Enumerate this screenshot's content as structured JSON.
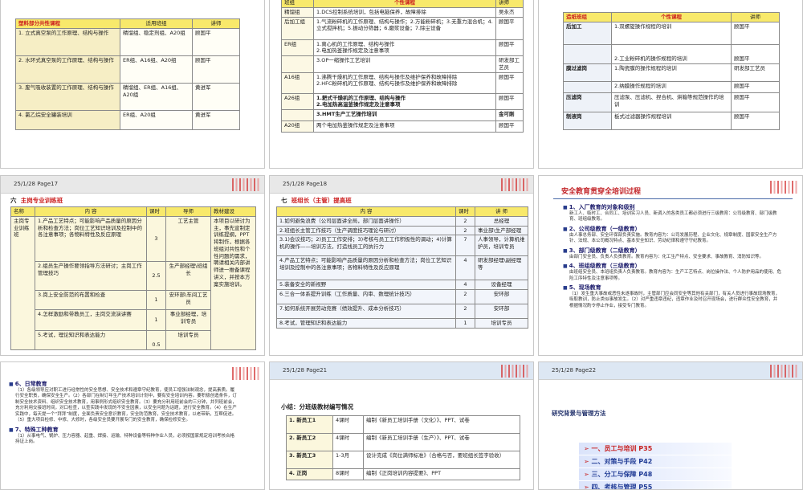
{
  "slide1": {
    "headers": [
      "塑料部分共性课程",
      "适用班组",
      "讲师"
    ],
    "rows": [
      [
        "1. 立式真空泵的工作原理、结构与操作",
        "精馏组、稳定剂组、A20组",
        "顾国平"
      ],
      [
        "2. 水环式真空泵的工作原理、结构与操作",
        "ER组、A16组、A20组",
        "顾国平"
      ],
      [
        "3. 废气吸收装置的工作原理、结构与操作",
        "精馏组、ER组、A16组、A20组",
        "黄进军"
      ],
      [
        "4. 氯乙烷安全罐装培训",
        "ER组、A20组",
        "黄进军"
      ]
    ]
  },
  "slide2": {
    "headers": [
      "班组",
      "个性课程",
      "讲师"
    ],
    "rows": [
      [
        "精馏组",
        "1.DCS控制系统培训，包括电脑保养，故障排除",
        "吴永杰"
      ],
      [
        "后加工组",
        "1.气流粉碎机的工作原理、结构与操作；2.万能粉碎机；3.无重力混合机；4.立式搅拌机；5.振动分筛器；6.磨浆设备；7.除尘设备",
        "顾国平"
      ],
      [
        "ER组",
        "1.离心机的工作原理、结构与操作\n2.电加热釜操作规定及注意事项",
        "顾国平"
      ],
      [
        "",
        "3.OP一缩操作工艺培训",
        "研发部工艺员"
      ],
      [
        "A16组",
        "1.沸腾干燥机的工作原理、结构与操作及维护保养和故障排除\n2.HFC粉碎机的工作原理、结构与操作及维护保养和故障排除",
        "顾国平"
      ],
      [
        "A26组",
        "1.耙式干燥机的工作原理、结构与操作\n2.电加热高温釜操作规定及注意事项",
        "顾国平"
      ],
      [
        "",
        "3.HMT生产工艺操作培训",
        "金可刚"
      ],
      [
        "A20组",
        "两个电加热釜操作规定及注意事项",
        "顾国平"
      ]
    ]
  },
  "slide3": {
    "headers": [
      "造纸班组",
      "个性课程",
      "讲师"
    ],
    "rows": [
      [
        "后加工",
        "1.双螺旋操作规程的培训",
        "顾国平"
      ],
      [
        "",
        "2.工业粉碎机的操作规程的培训",
        "顾国平"
      ],
      [
        "膜过滤岗",
        "1.陶瓷膜的操作规程的培训",
        "研发部工艺员"
      ],
      [
        "",
        "2.纳膜操作规程的培训",
        "顾国平"
      ],
      [
        "压滤岗",
        "压滤泵、压滤机、捏合机、烘箱等规范操作的培训",
        "顾国平"
      ],
      [
        "制液岗",
        "板式过滤器操作规程培训",
        "顾国平"
      ]
    ]
  },
  "slide4": {
    "page": "25/1/28   Page17",
    "title_num": "六",
    "title": "主岗专业训练班",
    "headers": [
      "名称",
      "内    容",
      "课时",
      "导师",
      "教材建设"
    ],
    "name": "主岗专业训练班",
    "material": "本项目以研讨为主，事先宣制定训练提纲，PPT将制作，根据各班组对共性和个性问题的需求，聘请相关内部讲师进一推备课程讲义，并按本方案实施培训。",
    "rows": [
      [
        "1.产品工艺特点；可能影响产品质量的原因分析和检查方法；岗位工艺知识培训及控制中的各注意事项；各物料特性及反应原理",
        "3",
        "工艺主管"
      ],
      [
        "2.组员生产操作要领指导方法研讨；主岗工作管理技巧",
        "2.5",
        "生产部经理\\班组长"
      ],
      [
        "3.岗上安全防范的布置和检查",
        "1",
        "安环部\\车间工艺员"
      ],
      [
        "4.怎样激励和带教员工，主岗交流演讲赛",
        "1",
        "事业部经理，培训专员"
      ],
      [
        "5.考试，理论知识和表达能力",
        "0.5",
        "培训专员"
      ]
    ]
  },
  "slide5": {
    "page": "25/1/28   Page18",
    "title_num": "七",
    "title": "班组长（主管）提高班",
    "headers": [
      "内    容",
      "课时",
      "讲    师"
    ],
    "rows": [
      [
        "1.如何避免浪费（公司层面讲全局，部门层面讲操作）",
        "2",
        "总经理"
      ],
      [
        "2.班组长主管工作技巧（生产调度技巧理论与研讨）",
        "2",
        "事业部\\生产部经理"
      ],
      [
        "3.1)会议技巧；2)员工工作安排；3)考核与员工工作积极性的调动；4)计算机的操作——培训方法，打造线员工的执行力",
        "7",
        "人事领导，计算机维护员，培训专员"
      ],
      [
        "4.产品工艺特点；可能影响产品质量的原因分析和检查方法；岗位工艺知识培训及控制中的各注意事项；各物料特性及反应原理",
        "4",
        "研发部经理\\副经理等"
      ],
      [
        "5.装备安全的新视野",
        "4",
        "设备经理"
      ],
      [
        "6.三合一体系提升训练（工作质量、内审、数理统计技巧）",
        "2",
        "安环部"
      ],
      [
        "7.如何系统开展劳动竞赛（绩效提升、成本分析技巧）",
        "2",
        "安环部"
      ],
      [
        "8.考试，管理知识和表达能力",
        "1",
        "培训专员"
      ]
    ]
  },
  "slide6": {
    "title": "安全教育贯穿全培训过程",
    "items": [
      {
        "h": "1、入厂教育的对象和级别",
        "p": "新工人、临时工、合同工、培训实习人员、新调入的各类员工都必须进行三级教育：公司级教育、部门级教育、班组级教育。"
      },
      {
        "h": "2、公司级教育（一级教育）",
        "p": "由人事总务部、安全环保部负责实施。教育内容为：公司发展历程、企业文化、规章制度、国家安全生产方针、法规、本公司概况特点、基本安全知识、劳动纪律和遵守守纪教育。"
      },
      {
        "h": "3、部门级教育（二级教育）",
        "p": "由部门安全员、负责人负责教育。教育内容为：化工生产特点、安全要求、事故教育、消防知识等。"
      },
      {
        "h": "4、班组级教育（三级教育）",
        "p": "由班组安全员、本班组负责人负责教育。教育内容为：生产工艺特点、岗位操作法、个人防护用品的使用、危险工序特性及注意事项等。"
      },
      {
        "h": "5、现场教育",
        "p": "（1）发生重大事故或恶性未遂事故时，主管部门应会同安全等其他有关部门，有关人员进行事故现场教育，吸取教训，防止类似事故发生。（2）对严重违章违纪，违章作业及时召开现场会，进行群众性安全教育，并根据情况酌令停止作业，接受专门教育。"
      }
    ]
  },
  "slide7": {
    "items": [
      {
        "h": "6、日常教育",
        "p": "（1）各级领导应对职工进行经常性的安全思想、安全技术和遵章守纪教育，使员工增强法制观念，提高素质。履行安全职责，确保安全生产。（2）各部门在制订年生产技术培训计划中，要有安全培训内容。要积极创造条件，订制安全技术资料、组织安全技术教育，用事例形式组织安全教育。（3）要充分利用班前会的三分钟，并列班前会，充分利用交接班时间，对口检查，以查实践中发现的不安全因素，以安全问题为话题，进行安全教育。（4）在生产实践中，每天提一个“拜拜”制度，全面负责安全意识教育，安全防范教育，安全技术教育，以老带新，互帮促进。（5）重大项目检修、中修、大修时，各级安全员要开展专门的安全教育，确保检修安全。"
      },
      {
        "h": "7、特殊工种教育",
        "p": "（1）从事电气、锅炉、压力容器、起重、焊接、运输、特种设备等特种作业人员，必须按国家规定培训考核合格持证上岗。"
      }
    ]
  },
  "slide8": {
    "page": "25/1/28   Page21",
    "title": "小结：分班级教材编写情况",
    "rows": [
      [
        "1. 新员工1",
        "4课时",
        "编制《新员工培训手册（文化）》、PPT、试卷"
      ],
      [
        "2. 新员工2",
        "4课时",
        "编制《新员工培训手册（生产）》、PPT、试卷"
      ],
      [
        "3. 新员工3",
        "1-3月",
        "设计完成《岗位满师标准》（合格与否，要班组长签字验收）"
      ],
      [
        "4. 正岗",
        "8课时",
        "编制《正岗培训内容提要》、PPT"
      ]
    ]
  },
  "slide9": {
    "page": "25/1/28   Page22",
    "title": "研究背景与管理方法",
    "menu": [
      "一、员工与培训 P35",
      "二、对策与手段 P42",
      "三、分工与保障 P48",
      "四、考核与管理 P55"
    ]
  },
  "colors": {
    "yellow": "#f8e96b",
    "red": "#cc1f1f",
    "navy": "#1b1b6b"
  }
}
